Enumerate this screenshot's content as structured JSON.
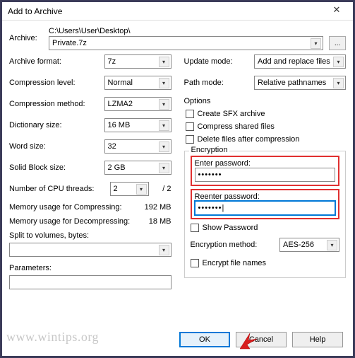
{
  "window": {
    "title": "Add to Archive"
  },
  "archive": {
    "label": "Archive:",
    "path": "C:\\Users\\User\\Desktop\\",
    "filename": "Private.7z",
    "browse": "..."
  },
  "left": {
    "format_lbl": "Archive format:",
    "format_val": "7z",
    "level_lbl": "Compression level:",
    "level_val": "Normal",
    "method_lbl": "Compression method:",
    "method_val": "LZMA2",
    "dict_lbl": "Dictionary size:",
    "dict_val": "16 MB",
    "word_lbl": "Word size:",
    "word_val": "32",
    "block_lbl": "Solid Block size:",
    "block_val": "2 GB",
    "threads_lbl": "Number of CPU threads:",
    "threads_val": "2",
    "threads_max": "/ 2",
    "mem_comp_lbl": "Memory usage for Compressing:",
    "mem_comp_val": "192 MB",
    "mem_decomp_lbl": "Memory usage for Decompressing:",
    "mem_decomp_val": "18 MB",
    "split_lbl": "Split to volumes, bytes:",
    "params_lbl": "Parameters:"
  },
  "right": {
    "update_lbl": "Update mode:",
    "update_val": "Add and replace files",
    "path_lbl": "Path mode:",
    "path_val": "Relative pathnames",
    "options_lbl": "Options",
    "opt_sfx": "Create SFX archive",
    "opt_shared": "Compress shared files",
    "opt_delete": "Delete files after compression",
    "enc_lbl": "Encryption",
    "enter_pw_lbl": "Enter password:",
    "enter_pw_val": "•••••••",
    "reenter_pw_lbl": "Reenter password:",
    "reenter_pw_val": "•••••••|",
    "show_pw": "Show Password",
    "enc_method_lbl": "Encryption method:",
    "enc_method_val": "AES-256",
    "enc_names": "Encrypt file names"
  },
  "buttons": {
    "ok": "OK",
    "cancel": "Cancel",
    "help": "Help"
  },
  "watermark": "www.wintips.org"
}
